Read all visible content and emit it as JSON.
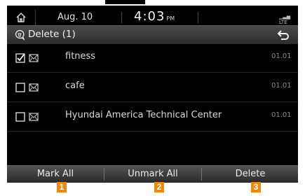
{
  "status": {
    "date": "Aug. 10",
    "time": "4:03",
    "ampm": "PM"
  },
  "header": {
    "title": "Delete (1)"
  },
  "messages": [
    {
      "label": "fitness",
      "date": "01.01",
      "checked": true
    },
    {
      "label": "cafe",
      "date": "01.01",
      "checked": false
    },
    {
      "label": "Hyundai America Technical Center",
      "date": "01.01",
      "checked": false
    }
  ],
  "bottom": {
    "mark_all": "Mark All",
    "unmark_all": "Unmark All",
    "delete": "Delete"
  },
  "markers": [
    "1",
    "2",
    "3"
  ],
  "colors": {
    "marker": "#f0880e",
    "background": "#000000"
  }
}
